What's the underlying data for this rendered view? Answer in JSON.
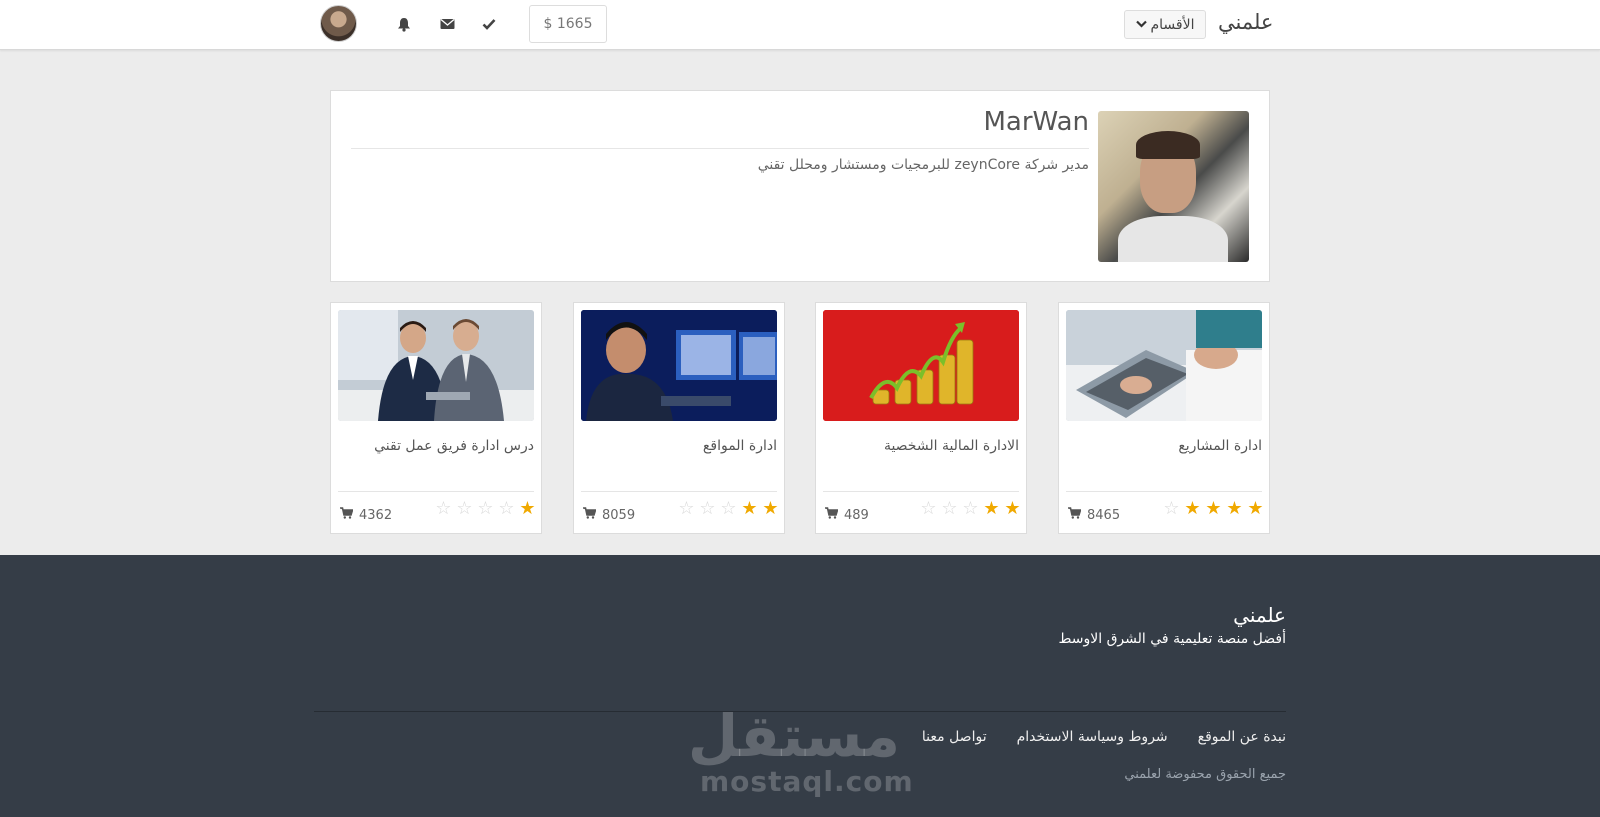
{
  "navbar": {
    "brand": "علمني",
    "categories_label": "الأقسام",
    "balance": "$ 1665",
    "icons": [
      "bell-icon",
      "envelope-icon",
      "check-icon",
      "chevron-down-icon"
    ]
  },
  "profile": {
    "name": "MarWan",
    "bio": "مدير شركة zeynCore للبرمجيات ومستشار ومحلل تقني"
  },
  "courses": [
    {
      "title": "ادارة المشاريع",
      "sales": "8465",
      "rating": 4
    },
    {
      "title": "الادارة المالية الشخصية",
      "sales": "489",
      "rating": 2
    },
    {
      "title": "ادارة المواقع",
      "sales": "8059",
      "rating": 2
    },
    {
      "title": "درس ادارة فريق عمل تقني",
      "sales": "4362",
      "rating": 1
    }
  ],
  "footer": {
    "brand": "علمني",
    "tagline": "أفضل منصة تعليمية في الشرق الاوسط",
    "links": [
      "نبدة عن الموقع",
      "شروط وسياسة الاستخدام",
      "تواصل معنا"
    ],
    "copyright": "جميع الحقوق محفوضة لعلمني",
    "watermark_ar": "مستقل",
    "watermark_en": "mostaql.com"
  },
  "colors": {
    "star_active": "#f0a900",
    "footer_bg": "#353d47",
    "page_bg": "#ececec"
  }
}
